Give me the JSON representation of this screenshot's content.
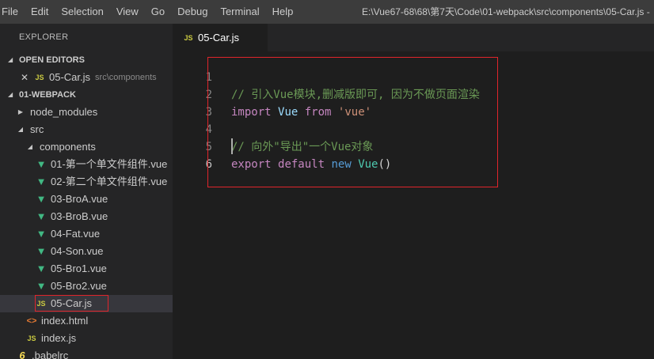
{
  "menu": [
    "File",
    "Edit",
    "Selection",
    "View",
    "Go",
    "Debug",
    "Terminal",
    "Help"
  ],
  "window_title": "E:\\Vue67-68\\68\\第7天\\Code\\01-webpack\\src\\components\\05-Car.js -",
  "sidebar": {
    "title": "EXPLORER",
    "open_editors_label": "OPEN EDITORS",
    "open_editor": {
      "icon": "JS",
      "name": "05-Car.js",
      "path": "src\\components"
    },
    "project_label": "01-WEBPACK",
    "node_modules": "node_modules",
    "src": "src",
    "components": "components",
    "vue_files": [
      "01-第一个单文件组件.vue",
      "02-第二个单文件组件.vue",
      "03-BroA.vue",
      "03-BroB.vue",
      "04-Fat.vue",
      "04-Son.vue",
      "05-Bro1.vue",
      "05-Bro2.vue"
    ],
    "selected_file": "05-Car.js",
    "index_html": "index.html",
    "index_js": "index.js",
    "babelrc": ".babelrc",
    "js_icon": "JS",
    "html_icon": "<>",
    "babel_icon": "6"
  },
  "tab": {
    "icon": "JS",
    "label": "05-Car.js"
  },
  "editor": {
    "line_numbers": [
      "1",
      "2",
      "3",
      "4",
      "5",
      "6"
    ],
    "line1_comment": "// 引入Vue模块,删减版即可, 因为不做页面渲染",
    "line2": {
      "kw": "import",
      "name": "Vue",
      "from": "from",
      "str": "'vue'"
    },
    "line4_comment": "// 向外\"导出\"一个Vue对象",
    "line5": {
      "kw1": "export",
      "kw2": "default",
      "kw3": "new",
      "cls": "Vue",
      "paren": "()"
    }
  },
  "colors": {
    "accent_red": "#e0252b",
    "vue_green": "#41b883",
    "js_yellow": "#cbcb41"
  }
}
